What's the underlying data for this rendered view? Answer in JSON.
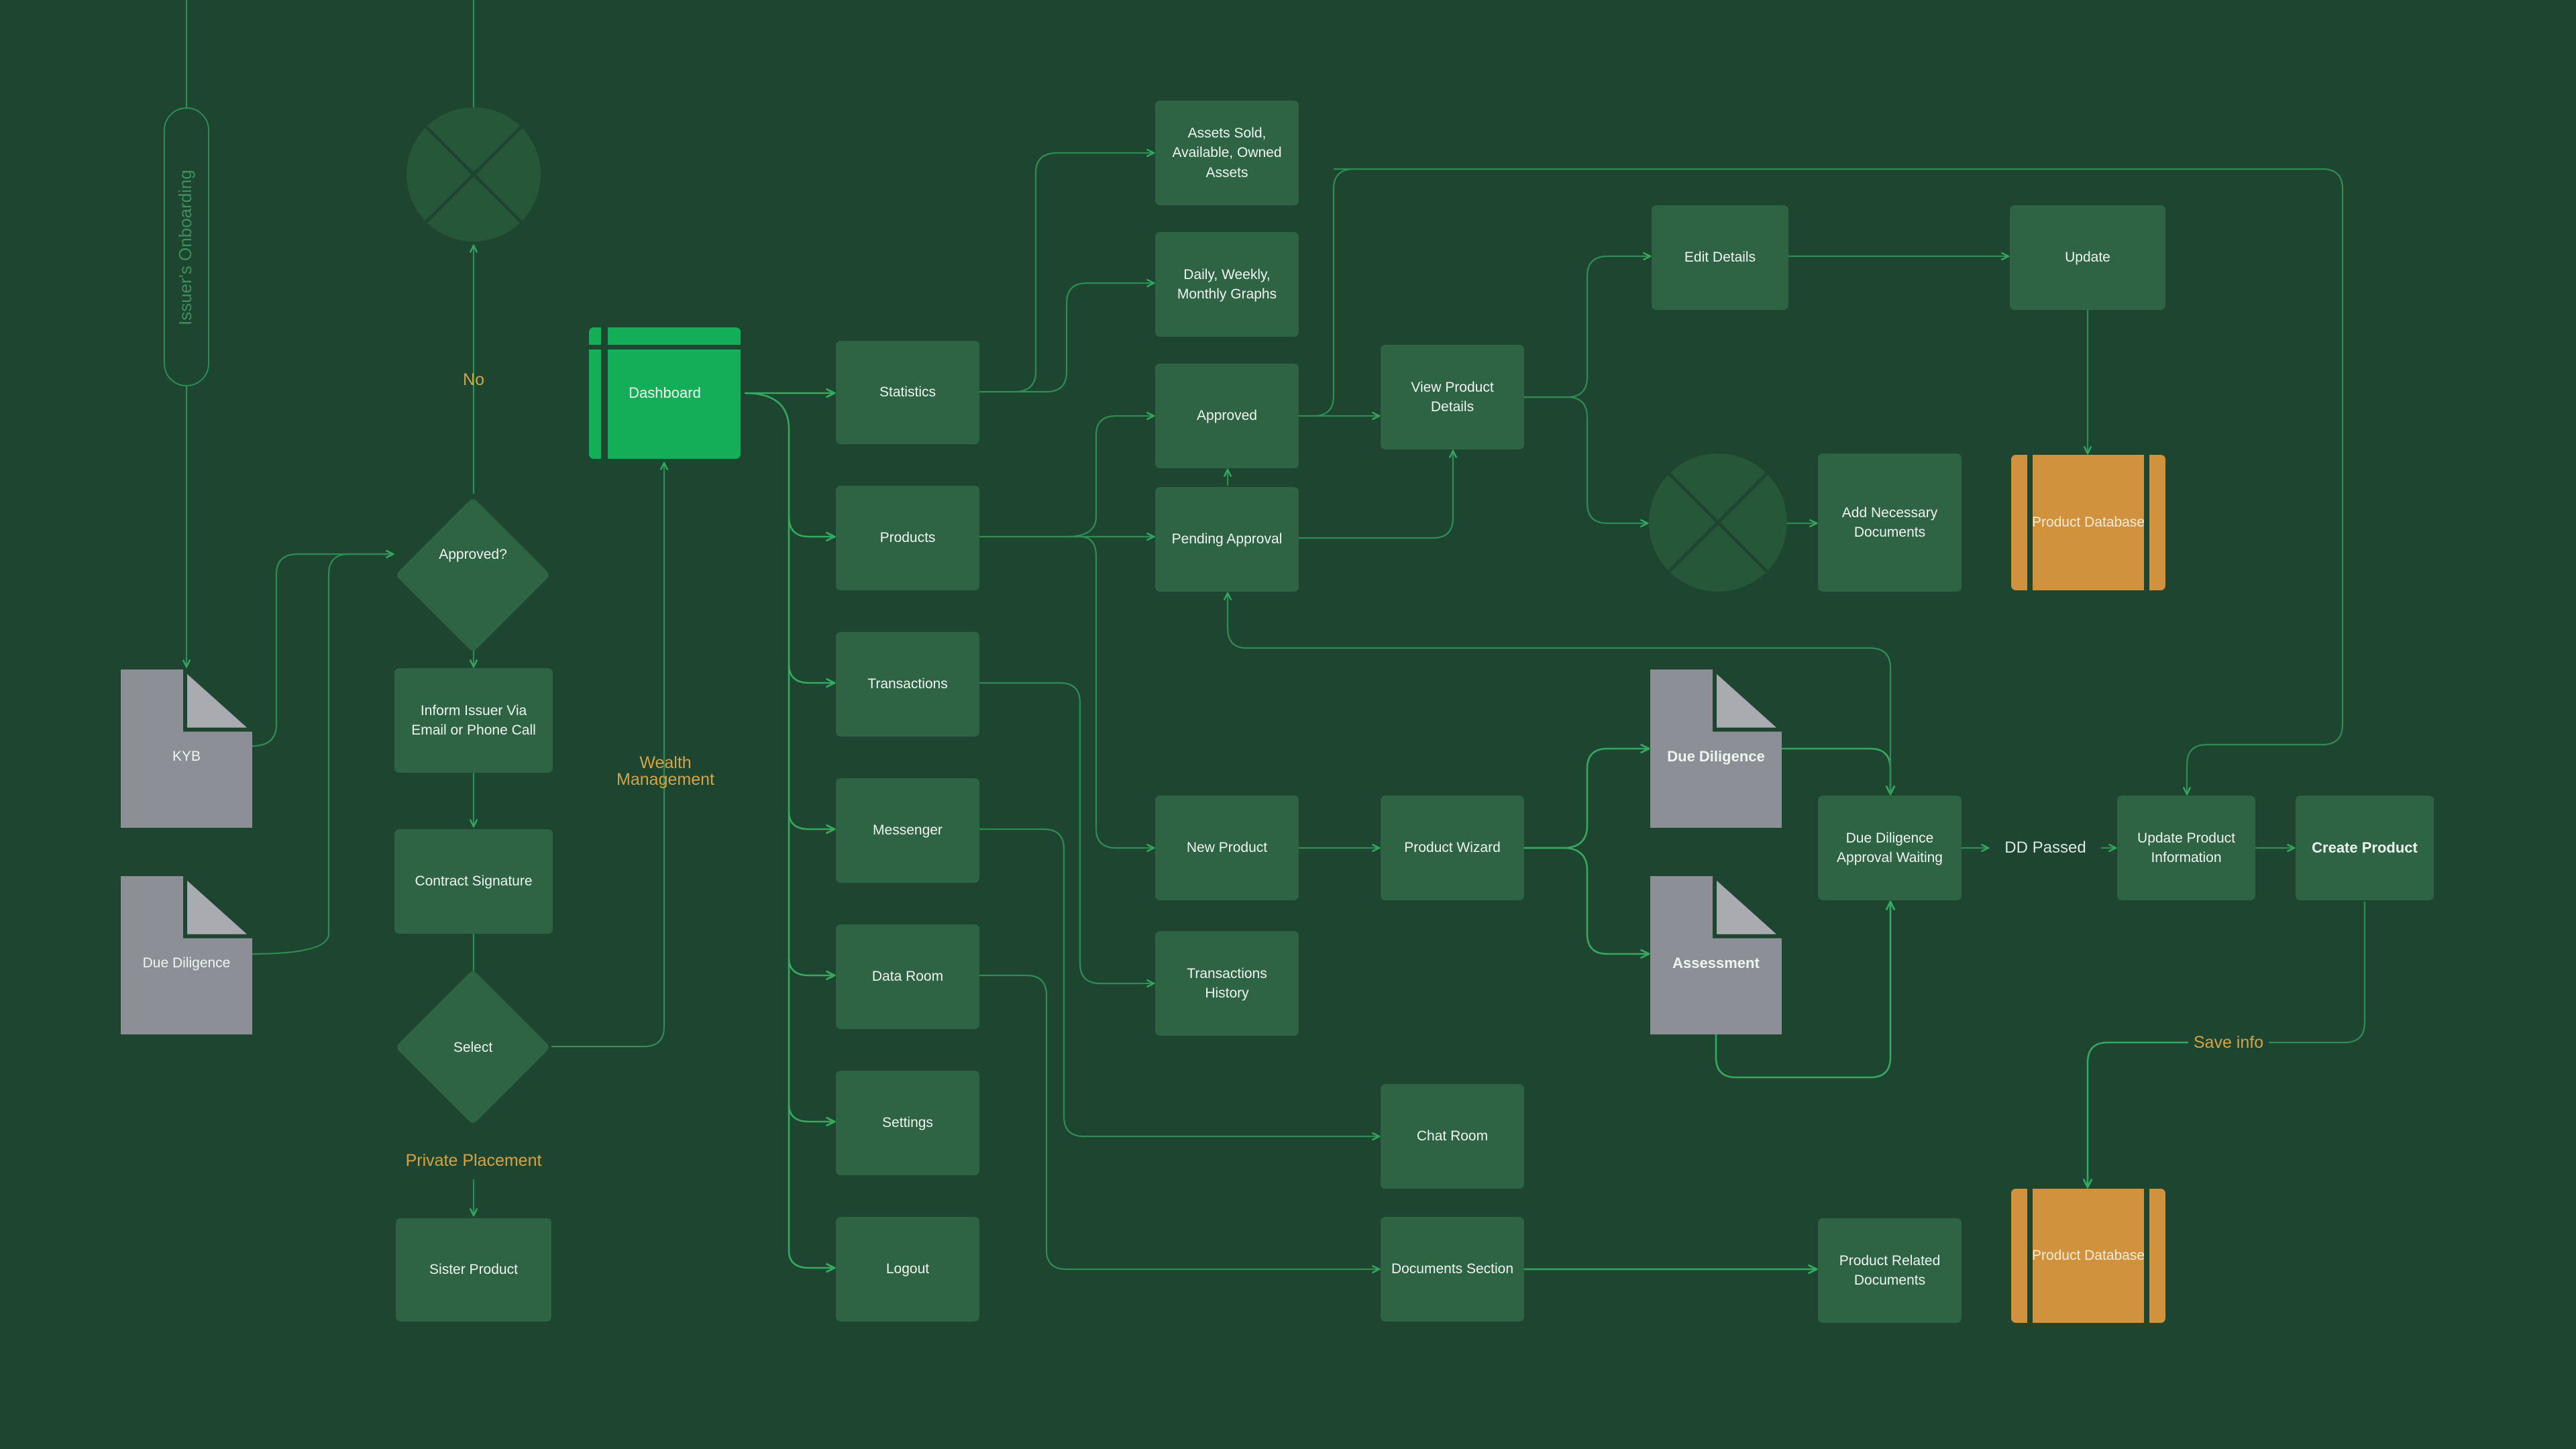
{
  "nodes": {
    "assets": "Assets Sold, Available, Owned Assets",
    "graphs": "Daily, Weekly, Monthly Graphs",
    "approved": "Approved",
    "pending": "Pending Approval",
    "view_details": "View Product Details",
    "edit_details": "Edit Details",
    "update": "Update",
    "add_docs": "Add Necessary Documents",
    "product_db_top": "Product Database",
    "dashboard": "Dashboard",
    "statistics": "Statistics",
    "products": "Products",
    "transactions": "Transactions",
    "messenger": "Messenger",
    "data_room": "Data Room",
    "settings": "Settings",
    "logout": "Logout",
    "new_product": "New Product",
    "product_wizard": "Product Wizard",
    "dd_doc": "Due Diligence",
    "assessment_doc": "Assessment",
    "dd_waiting": "Due Diligence Approval Waiting",
    "update_info": "Update Product Information",
    "create_product": "Create Product",
    "transactions_history": "Transactions History",
    "chat_room": "Chat Room",
    "documents_section": "Documents Section",
    "product_related_docs": "Product Related Documents",
    "product_db_bottom": "Product Database",
    "kyb": "KYB",
    "due_diligence_left": "Due Diligence",
    "approved_q": "Approved?",
    "inform_issuer": "Inform Issuer Via Email or Phone Call",
    "contract_signature": "Contract Signature",
    "select": "Select",
    "sister_product": "Sister Product",
    "onboarding": "Issuer's Onboarding"
  },
  "labels": {
    "no": "No",
    "wealth": "Wealth Management",
    "private": "Private Placement",
    "dd_passed": "DD Passed",
    "save_info": "Save info"
  },
  "colors": {
    "background": "#1d4530",
    "box": "#2e6344",
    "dashboard": "#15ae58",
    "database": "#d0923c",
    "document": "#8d8f96",
    "connector": "#2f8c55",
    "label_amber": "#d4a347"
  },
  "icons": {
    "reject": "x-circle-icon",
    "document": "document-icon",
    "database": "database-icon"
  }
}
